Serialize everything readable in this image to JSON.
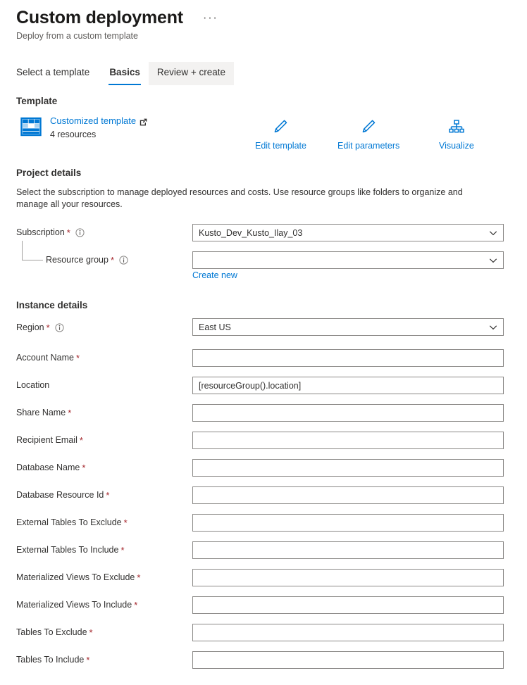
{
  "header": {
    "title": "Custom deployment",
    "subtitle": "Deploy from a custom template",
    "more_menu": "···"
  },
  "tabs": [
    {
      "label": "Select a template",
      "active": false,
      "hover": false
    },
    {
      "label": "Basics",
      "active": true,
      "hover": false
    },
    {
      "label": "Review + create",
      "active": false,
      "hover": true
    }
  ],
  "template_section": {
    "title": "Template",
    "icon": "template-grid-icon",
    "link_label": "Customized template",
    "link_external_icon": "external-link-icon",
    "resources_label": "4 resources",
    "actions": [
      {
        "label": "Edit template",
        "icon": "pencil-icon"
      },
      {
        "label": "Edit parameters",
        "icon": "pencil-icon"
      },
      {
        "label": "Visualize",
        "icon": "hierarchy-icon"
      }
    ]
  },
  "project_details": {
    "title": "Project details",
    "description": "Select the subscription to manage deployed resources and costs. Use resource groups like folders to organize and manage all your resources.",
    "subscription": {
      "label": "Subscription",
      "required": true,
      "info_icon": "info-icon",
      "value": "Kusto_Dev_Kusto_Ilay_03",
      "chevron_icon": "chevron-down-icon"
    },
    "resource_group": {
      "label": "Resource group",
      "required": true,
      "info_icon": "info-icon",
      "value": "",
      "chevron_icon": "chevron-down-icon",
      "create_new_label": "Create new"
    }
  },
  "instance_details": {
    "title": "Instance details",
    "region": {
      "label": "Region",
      "required": true,
      "info_icon": "info-icon",
      "value": "East US",
      "chevron_icon": "chevron-down-icon"
    },
    "fields": [
      {
        "label": "Account Name",
        "required": true,
        "value": ""
      },
      {
        "label": "Location",
        "required": false,
        "value": "[resourceGroup().location]"
      },
      {
        "label": "Share Name",
        "required": true,
        "value": ""
      },
      {
        "label": "Recipient Email",
        "required": true,
        "value": ""
      },
      {
        "label": "Database Name",
        "required": true,
        "value": ""
      },
      {
        "label": "Database Resource Id",
        "required": true,
        "value": ""
      },
      {
        "label": "External Tables To Exclude",
        "required": true,
        "value": ""
      },
      {
        "label": "External Tables To Include",
        "required": true,
        "value": ""
      },
      {
        "label": "Materialized Views To Exclude",
        "required": true,
        "value": ""
      },
      {
        "label": "Materialized Views To Include",
        "required": true,
        "value": ""
      },
      {
        "label": "Tables To Exclude",
        "required": true,
        "value": ""
      },
      {
        "label": "Tables To Include",
        "required": true,
        "value": ""
      }
    ]
  },
  "colors": {
    "accent": "#0078d4",
    "required_asterisk": "#a4262c",
    "border": "#8a8886",
    "text": "#323130",
    "muted_text": "#605e5c",
    "tab_hover_bg": "#f3f2f1"
  }
}
